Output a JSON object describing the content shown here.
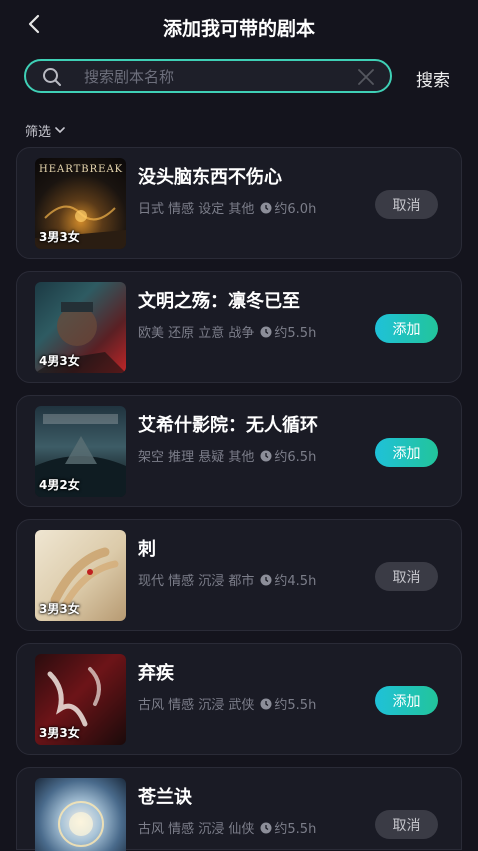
{
  "header": {
    "title": "添加我可带的剧本"
  },
  "search": {
    "placeholder": "搜索剧本名称",
    "value": "",
    "button_label": "搜索"
  },
  "filter": {
    "label": "筛选"
  },
  "colors": {
    "accent": "#3fd0b6",
    "add_button": "#1fc1d8",
    "background": "#14141d",
    "card": "#1a1b25"
  },
  "scripts": [
    {
      "name": "没头脑东西不伤心",
      "tags": "日式 情感 设定 其他",
      "duration": "约6.0h",
      "cast": "3男3女",
      "cover_text": "HEARTBREAK",
      "action": "取消",
      "state": "cancel"
    },
    {
      "name": "文明之殇：凛冬已至",
      "tags": "欧美 还原 立意 战争",
      "duration": "约5.5h",
      "cast": "4男3女",
      "cover_text": "",
      "action": "添加",
      "state": "add"
    },
    {
      "name": "艾希什影院：无人循环",
      "tags": "架空 推理 悬疑 其他",
      "duration": "约6.5h",
      "cast": "4男2女",
      "cover_text": "",
      "action": "添加",
      "state": "add"
    },
    {
      "name": "刺",
      "tags": "现代 情感 沉浸 都市",
      "duration": "约4.5h",
      "cast": "3男3女",
      "cover_text": "",
      "action": "取消",
      "state": "cancel"
    },
    {
      "name": "弃疾",
      "tags": "古风 情感 沉浸 武侠",
      "duration": "约5.5h",
      "cast": "3男3女",
      "cover_text": "",
      "action": "添加",
      "state": "add"
    },
    {
      "name": "苍兰诀",
      "tags": "古风 情感 沉浸 仙侠",
      "duration": "约5.5h",
      "cast": "",
      "cover_text": "",
      "action": "取消",
      "state": "cancel"
    }
  ]
}
